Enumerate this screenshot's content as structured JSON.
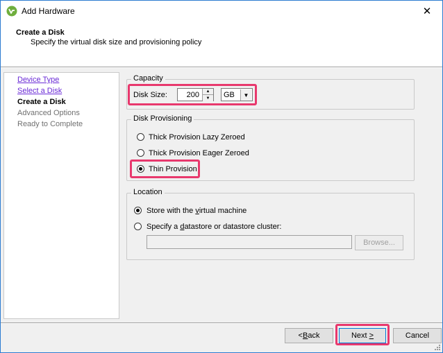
{
  "window": {
    "title": "Add Hardware",
    "close_symbol": "✕"
  },
  "header": {
    "title": "Create a Disk",
    "subtitle": "Specify the virtual disk size and provisioning policy"
  },
  "steps": [
    {
      "label": "Device Type",
      "state": "link"
    },
    {
      "label": "Select a Disk",
      "state": "link"
    },
    {
      "label": "Create a Disk",
      "state": "current"
    },
    {
      "label": "Advanced Options",
      "state": "future"
    },
    {
      "label": "Ready to Complete",
      "state": "future"
    }
  ],
  "capacity": {
    "legend": "Capacity",
    "disk_size_label": "Disk Size:",
    "disk_size_value": "200",
    "unit_value": "GB"
  },
  "provisioning": {
    "legend": "Disk Provisioning",
    "options": [
      {
        "label": "Thick Provision Lazy Zeroed",
        "checked": false
      },
      {
        "label": "Thick Provision Eager Zeroed",
        "checked": false
      },
      {
        "label": "Thin Provision",
        "checked": true
      }
    ]
  },
  "location": {
    "legend": "Location",
    "store_prefix": "Store with the ",
    "store_accel": "v",
    "store_suffix": "irtual machine",
    "specify_prefix": "Specify a ",
    "specify_accel": "d",
    "specify_suffix": "atastore or datastore cluster:",
    "datastore_value": "",
    "browse_label": "Browse..."
  },
  "buttons": {
    "back_accel": "B",
    "back_rest": "ack",
    "back_prefix": "< ",
    "next_prefix": "Next ",
    "next_accel": ">",
    "cancel": "Cancel"
  },
  "colors": {
    "highlight": "#e8386d",
    "link": "#6a2ad6",
    "accent": "#0078d7"
  },
  "icons": {
    "app": "vsphere-logo-icon",
    "close": "close-icon"
  }
}
